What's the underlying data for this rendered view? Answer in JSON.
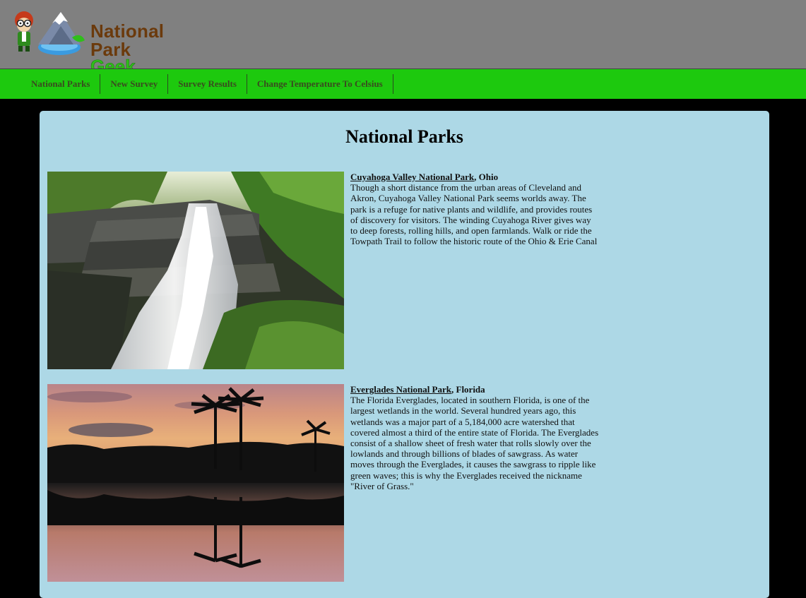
{
  "header": {
    "logo_line1": "National Park",
    "logo_line2": "Geek"
  },
  "nav": {
    "items": [
      {
        "label": "National Parks"
      },
      {
        "label": "New Survey"
      },
      {
        "label": "Survey Results"
      },
      {
        "label": "Change Temperature To Celsius"
      }
    ]
  },
  "main": {
    "title": "National Parks",
    "parks": [
      {
        "name": "Cuyahoga Valley National Park",
        "state": ", Ohio",
        "description": "Though a short distance from the urban areas of Cleveland and Akron, Cuyahoga Valley National Park seems worlds away. The park is a refuge for native plants and wildlife, and provides routes of discovery for visitors. The winding Cuyahoga River gives way to deep forests, rolling hills, and open farmlands. Walk or ride the Towpath Trail to follow the historic route of the Ohio & Erie Canal"
      },
      {
        "name": "Everglades National Park",
        "state": ", Florida",
        "description": "The Florida Everglades, located in southern Florida, is one of the largest wetlands in the world. Several hundred years ago, this wetlands was a major part of a 5,184,000 acre watershed that covered almost a third of the entire state of Florida. The Everglades consist of a shallow sheet of fresh water that rolls slowly over the lowlands and through billions of blades of sawgrass. As water moves through the Everglades, it causes the sawgrass to ripple like green waves; this is why the Everglades received the nickname \"River of Grass.\""
      }
    ]
  },
  "colors": {
    "header_bg": "#808080",
    "nav_bg": "#1dc90e",
    "panel_bg": "#add8e6",
    "page_bg": "#000000"
  }
}
